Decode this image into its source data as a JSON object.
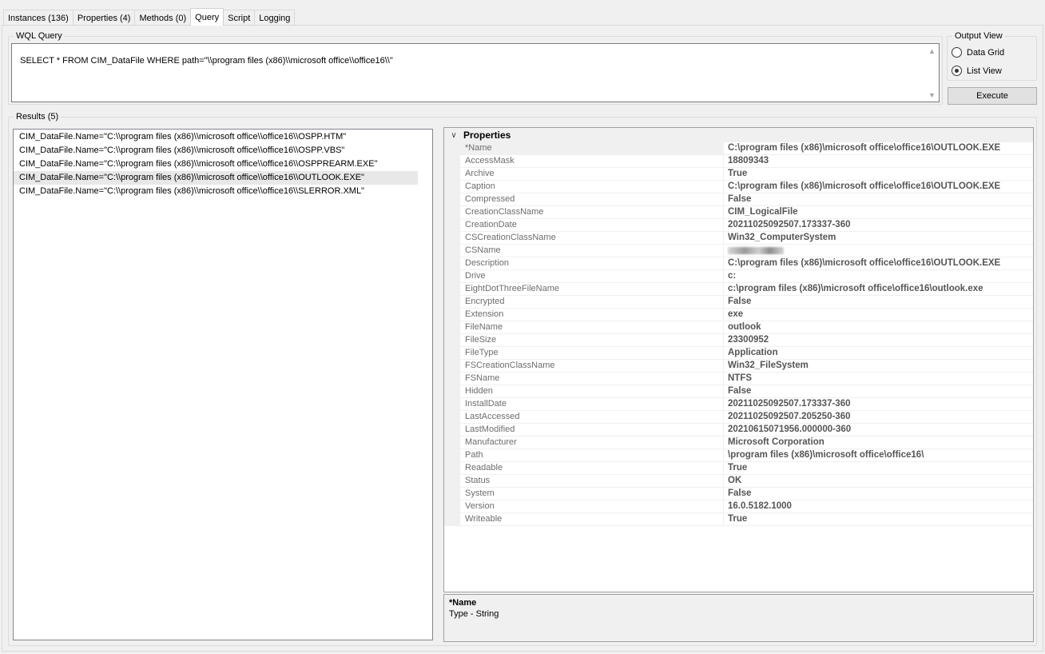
{
  "tabs": [
    {
      "label": "Instances (136)"
    },
    {
      "label": "Properties (4)"
    },
    {
      "label": "Methods (0)"
    },
    {
      "label": "Query"
    },
    {
      "label": "Script"
    },
    {
      "label": "Logging"
    }
  ],
  "active_tab": "Query",
  "wql": {
    "group_title": "WQL Query",
    "query": "SELECT * FROM CIM_DataFile WHERE path=\"\\\\program files (x86)\\\\microsoft office\\\\office16\\\\\""
  },
  "output_view": {
    "group_title": "Output View",
    "options": [
      {
        "label": "Data Grid",
        "checked": false
      },
      {
        "label": "List View",
        "checked": true
      }
    ]
  },
  "execute_label": "Execute",
  "results": {
    "group_title": "Results (5)",
    "items": [
      "CIM_DataFile.Name=\"C:\\\\program files (x86)\\\\microsoft office\\\\office16\\\\OSPP.HTM\"",
      "CIM_DataFile.Name=\"C:\\\\program files (x86)\\\\microsoft office\\\\office16\\\\OSPP.VBS\"",
      "CIM_DataFile.Name=\"C:\\\\program files (x86)\\\\microsoft office\\\\office16\\\\OSPPREARM.EXE\"",
      "CIM_DataFile.Name=\"C:\\\\program files (x86)\\\\microsoft office\\\\office16\\\\OUTLOOK.EXE\"",
      "CIM_DataFile.Name=\"C:\\\\program files (x86)\\\\microsoft office\\\\office16\\\\SLERROR.XML\""
    ],
    "selected_index": 3
  },
  "properties": {
    "category": "Properties",
    "rows": [
      {
        "name": "*Name",
        "value": "C:\\program files (x86)\\microsoft office\\office16\\OUTLOOK.EXE"
      },
      {
        "name": "AccessMask",
        "value": "18809343"
      },
      {
        "name": "Archive",
        "value": "True"
      },
      {
        "name": "Caption",
        "value": "C:\\program files (x86)\\microsoft office\\office16\\OUTLOOK.EXE"
      },
      {
        "name": "Compressed",
        "value": "False"
      },
      {
        "name": "CreationClassName",
        "value": "CIM_LogicalFile"
      },
      {
        "name": "CreationDate",
        "value": "20211025092507.173337-360"
      },
      {
        "name": "CSCreationClassName",
        "value": "Win32_ComputerSystem"
      },
      {
        "name": "CSName",
        "value": ""
      },
      {
        "name": "Description",
        "value": "C:\\program files (x86)\\microsoft office\\office16\\OUTLOOK.EXE"
      },
      {
        "name": "Drive",
        "value": "c:"
      },
      {
        "name": "EightDotThreeFileName",
        "value": "c:\\program files (x86)\\microsoft office\\office16\\outlook.exe"
      },
      {
        "name": "Encrypted",
        "value": "False"
      },
      {
        "name": "Extension",
        "value": "exe"
      },
      {
        "name": "FileName",
        "value": "outlook"
      },
      {
        "name": "FileSize",
        "value": "23300952"
      },
      {
        "name": "FileType",
        "value": "Application"
      },
      {
        "name": "FSCreationClassName",
        "value": "Win32_FileSystem"
      },
      {
        "name": "FSName",
        "value": "NTFS"
      },
      {
        "name": "Hidden",
        "value": "False"
      },
      {
        "name": "InstallDate",
        "value": "20211025092507.173337-360"
      },
      {
        "name": "LastAccessed",
        "value": "20211025092507.205250-360"
      },
      {
        "name": "LastModified",
        "value": "20210615071956.000000-360"
      },
      {
        "name": "Manufacturer",
        "value": "Microsoft Corporation"
      },
      {
        "name": "Path",
        "value": "\\program files (x86)\\microsoft office\\office16\\"
      },
      {
        "name": "Readable",
        "value": "True"
      },
      {
        "name": "Status",
        "value": "OK"
      },
      {
        "name": "System",
        "value": "False"
      },
      {
        "name": "Version",
        "value": "16.0.5182.1000"
      },
      {
        "name": "Writeable",
        "value": "True"
      }
    ]
  },
  "help": {
    "title": "*Name",
    "description": "Type - String"
  }
}
